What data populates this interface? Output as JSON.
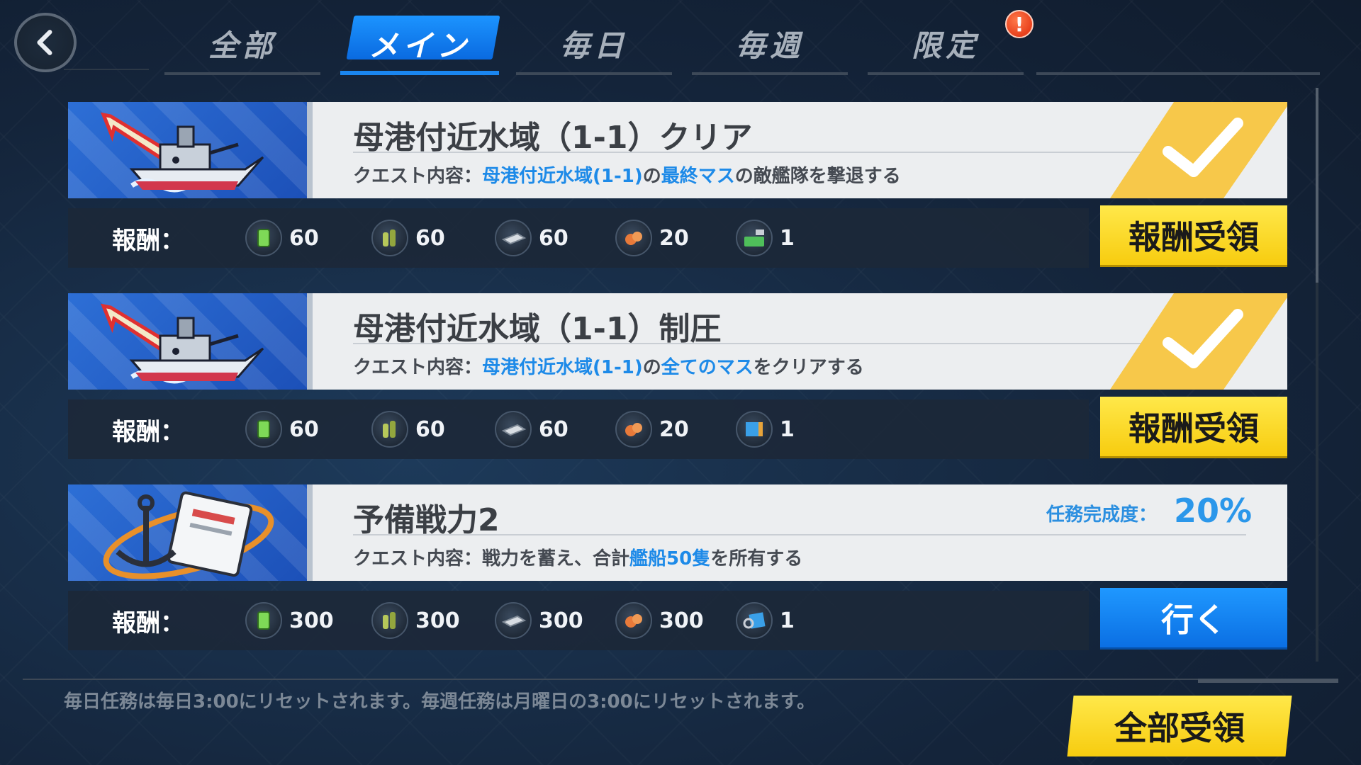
{
  "tabs": [
    {
      "label": "全部",
      "active": false
    },
    {
      "label": "メイン",
      "active": true
    },
    {
      "label": "毎日",
      "active": false
    },
    {
      "label": "毎週",
      "active": false
    },
    {
      "label": "限定",
      "active": false,
      "alert": "!"
    }
  ],
  "reward_label": "報酬：",
  "quests": [
    {
      "title": "母港付近水域（1-1）クリア",
      "desc_prefix": "クエスト内容：",
      "desc_hl1": "母港付近水域(1-1)",
      "desc_mid": "の",
      "desc_hl2": "最終マス",
      "desc_suffix": "の敵艦隊を撃退する",
      "completed": true,
      "rewards": [
        {
          "icon": "fuel-icon",
          "value": "60"
        },
        {
          "icon": "ammo-icon",
          "value": "60"
        },
        {
          "icon": "steel-icon",
          "value": "60"
        },
        {
          "icon": "bauxite-icon",
          "value": "20"
        },
        {
          "icon": "repair-kit-icon",
          "value": "1"
        }
      ],
      "button": "報酬受領"
    },
    {
      "title": "母港付近水域（1-1）制圧",
      "desc_prefix": "クエスト内容：",
      "desc_hl1": "母港付近水域(1-1)",
      "desc_mid": "の",
      "desc_hl2": "全てのマス",
      "desc_suffix": "をクリアする",
      "completed": true,
      "rewards": [
        {
          "icon": "fuel-icon",
          "value": "60"
        },
        {
          "icon": "ammo-icon",
          "value": "60"
        },
        {
          "icon": "steel-icon",
          "value": "60"
        },
        {
          "icon": "bauxite-icon",
          "value": "20"
        },
        {
          "icon": "blueprint-icon",
          "value": "1"
        }
      ],
      "button": "報酬受領"
    },
    {
      "title": "予備戦力2",
      "desc_prefix": "クエスト内容：",
      "desc_plain": "戦力を蓄え、合計",
      "desc_hl1": "艦船50隻",
      "desc_suffix": "を所有する",
      "completed": false,
      "progress_label": "任務完成度：",
      "progress_value": "20%",
      "rewards": [
        {
          "icon": "fuel-icon",
          "value": "300"
        },
        {
          "icon": "ammo-icon",
          "value": "300"
        },
        {
          "icon": "steel-icon",
          "value": "300"
        },
        {
          "icon": "bauxite-icon",
          "value": "300"
        },
        {
          "icon": "build-ticket-icon",
          "value": "1"
        }
      ],
      "button": "行く"
    }
  ],
  "footer_note": "毎日任務は毎日3:00にリセットされます。毎週任務は月曜日の3:00にリセットされます。",
  "claim_all": "全部受領",
  "colors": {
    "accent_blue": "#1d8ae8",
    "claim_yellow": "#f7cc0f",
    "tab_active": "#0a6ae0"
  }
}
